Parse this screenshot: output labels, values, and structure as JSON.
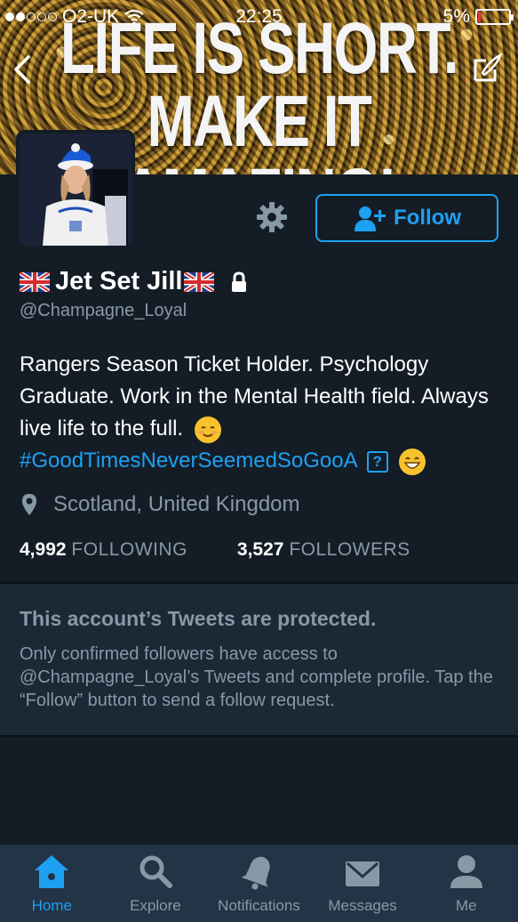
{
  "status_bar": {
    "carrier": "O2-UK",
    "time": "22:25",
    "battery": "5%"
  },
  "banner": {
    "line1": "LIFE IS SHORT.",
    "line2": "MAKE IT AMAZING!"
  },
  "profile": {
    "name": "Jet Set Jill",
    "handle": "@Champagne_Loyal",
    "follow_label": "Follow",
    "bio_text": "Rangers Season Ticket Holder. Psychology Graduate. Work in the Mental Health field. Always live life to the full.",
    "hashtag": "#GoodTimesNeverSeemedSoGooA",
    "unknown_char": "?",
    "location": "Scotland, United Kingdom",
    "following_count": "4,992",
    "following_label": "FOLLOWING",
    "followers_count": "3,527",
    "followers_label": "FOLLOWERS"
  },
  "protected": {
    "title": "This account’s Tweets are protected.",
    "body": "Only confirmed followers have access to @Champagne_Loyal’s Tweets and complete profile. Tap the “Follow” button to send a follow request."
  },
  "tabs": [
    {
      "label": "Home",
      "icon": "home-icon",
      "active": true
    },
    {
      "label": "Explore",
      "icon": "search-icon",
      "active": false
    },
    {
      "label": "Notifications",
      "icon": "bell-icon",
      "active": false
    },
    {
      "label": "Messages",
      "icon": "envelope-icon",
      "active": false
    },
    {
      "label": "Me",
      "icon": "person-icon",
      "active": false
    }
  ],
  "colors": {
    "accent": "#1da1f2",
    "background": "#141d26",
    "muted_text": "#8899a6",
    "tabbar": "#243447"
  }
}
